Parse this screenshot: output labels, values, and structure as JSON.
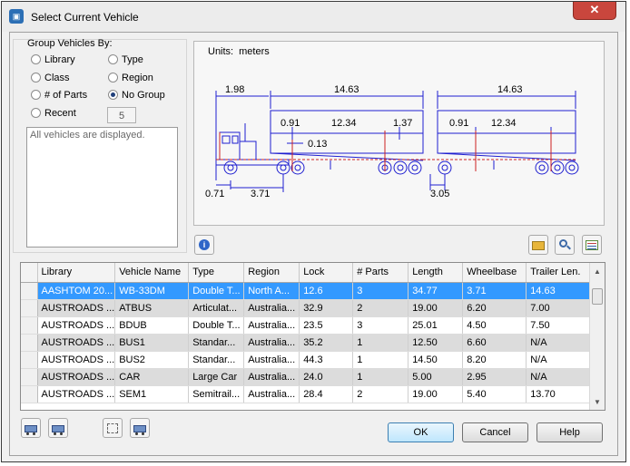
{
  "window": {
    "title": "Select Current Vehicle",
    "close_glyph": "✕"
  },
  "group": {
    "title": "Group Vehicles By:",
    "options": [
      {
        "label": "Library",
        "selected": false
      },
      {
        "label": "Type",
        "selected": false
      },
      {
        "label": "Class",
        "selected": false
      },
      {
        "label": "Region",
        "selected": false
      },
      {
        "label": "# of Parts",
        "selected": false
      },
      {
        "label": "No Group",
        "selected": true
      },
      {
        "label": "Recent",
        "selected": false
      }
    ],
    "recent_count": "5",
    "description": "All vehicles are displayed."
  },
  "diagram": {
    "units_label": "Units:",
    "units_value": "meters",
    "dims": {
      "front": "1.98",
      "trailer1_len": "14.63",
      "trailer2_len": "14.63",
      "t1_a": "0.91",
      "t1_b": "12.34",
      "t1_c": "1.37",
      "t2_a": "0.91",
      "t2_b": "12.34",
      "hitch": "0.13",
      "bottom_a": "0.71",
      "bottom_b": "3.71",
      "bottom_c": "3.05"
    },
    "line_color": "#1f1fd0",
    "red_color": "#cc2020"
  },
  "table": {
    "columns": [
      "Library",
      "Vehicle Name",
      "Type",
      "Region",
      "Lock",
      "# Parts",
      "Length",
      "Wheelbase",
      "Trailer Len."
    ],
    "rows": [
      [
        "AASHTOM 20...",
        "WB-33DM",
        "Double T...",
        "North A...",
        "12.6",
        "3",
        "34.77",
        "3.71",
        "14.63"
      ],
      [
        "AUSTROADS ...",
        "ATBUS",
        "Articulat...",
        "Australia...",
        "32.9",
        "2",
        "19.00",
        "6.20",
        "7.00"
      ],
      [
        "AUSTROADS ...",
        "BDUB",
        "Double T...",
        "Australia...",
        "23.5",
        "3",
        "25.01",
        "4.50",
        "7.50"
      ],
      [
        "AUSTROADS ...",
        "BUS1",
        "Standar...",
        "Australia...",
        "35.2",
        "1",
        "12.50",
        "6.60",
        "N/A"
      ],
      [
        "AUSTROADS ...",
        "BUS2",
        "Standar...",
        "Australia...",
        "44.3",
        "1",
        "14.50",
        "8.20",
        "N/A"
      ],
      [
        "AUSTROADS ...",
        "CAR",
        "Large Car",
        "Australia...",
        "24.0",
        "1",
        "5.00",
        "2.95",
        "N/A"
      ],
      [
        "AUSTROADS ...",
        "SEM1",
        "Semitrail...",
        "Australia...",
        "28.4",
        "2",
        "19.00",
        "5.40",
        "13.70"
      ]
    ],
    "selected_row": 0
  },
  "buttons": {
    "ok": "OK",
    "cancel": "Cancel",
    "help": "Help",
    "info_glyph": "i"
  },
  "colors": {
    "selection": "#3399ff",
    "alt_row": "#dcdcdc"
  }
}
